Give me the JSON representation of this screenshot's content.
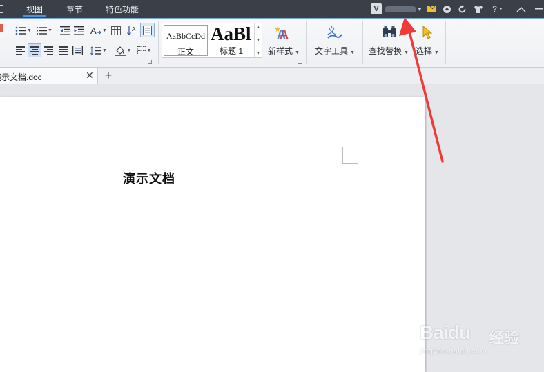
{
  "menubar": {
    "items": [
      {
        "label": "视图",
        "active": true
      },
      {
        "label": "章节",
        "active": false
      },
      {
        "label": "特色功能",
        "active": false
      }
    ],
    "user_badge": "V",
    "help_label": "?"
  },
  "ribbon": {
    "styles": {
      "normal_preview": "AaBbCcDd",
      "normal_label": "正文",
      "heading_preview": "AaBl",
      "heading_label": "标题 1"
    },
    "new_style_label": "新样式",
    "text_tools_label": "文字工具",
    "find_replace_label": "查找替换",
    "select_label": "选择"
  },
  "tabs": {
    "document_title": "演示文档.doc",
    "new_tab_symbol": "+"
  },
  "document": {
    "heading": "演示文档"
  },
  "watermark": {
    "brand": "Baidu",
    "suffix": "经验",
    "url": "jingyan.baidu.com"
  },
  "colors": {
    "menubar_bg": "#3b3f48",
    "accent_blue": "#4d8ee0",
    "annotation_red": "#f03a3a",
    "mail_yellow": "#f3c02b"
  }
}
